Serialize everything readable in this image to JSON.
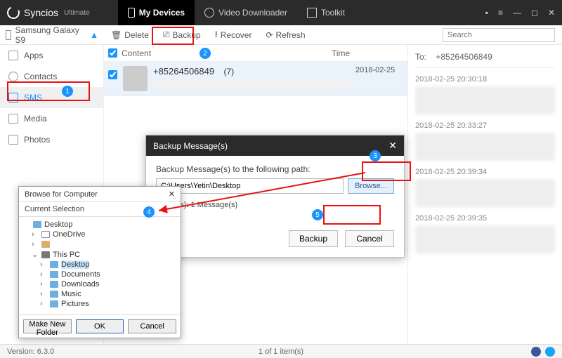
{
  "app": {
    "name": "Syncios",
    "edition": "Ultimate"
  },
  "nav": {
    "my_devices": "My Devices",
    "video_downloader": "Video Downloader",
    "toolkit": "Toolkit"
  },
  "device": {
    "name": "Samsung Galaxy S9"
  },
  "toolbar": {
    "delete": "Delete",
    "backup": "Backup",
    "recover": "Recover",
    "refresh": "Refresh"
  },
  "search": {
    "placeholder": "Search"
  },
  "sidebar": {
    "apps": "Apps",
    "contacts": "Contacts",
    "sms": "SMS",
    "media": "Media",
    "photos": "Photos"
  },
  "listhead": {
    "content": "Content",
    "time": "Time"
  },
  "conversation": {
    "number": "+85264506849",
    "count": "(7)",
    "time": "2018-02-25"
  },
  "rightpane": {
    "to_label": "To:",
    "to_value": "+85264506849",
    "msg_times": [
      "2018-02-25 20:30:18",
      "2018-02-25 20:33:27",
      "2018-02-25 20:39:34",
      "2018-02-25 20:39:35"
    ]
  },
  "backup_dialog": {
    "title": "Backup Message(s)",
    "prompt": "Backup Message(s) to the following path:",
    "path": "C:\\Users\\Yetin\\Desktop",
    "browse": "Browse...",
    "info": "1 Item(s): 1 Message(s)",
    "backup": "Backup",
    "cancel": "Cancel"
  },
  "browse_dialog": {
    "title": "Browse for Computer",
    "subtitle": "Current Selection",
    "tree": {
      "desktop": "Desktop",
      "onedrive": "OneDrive",
      "thispc": "This PC",
      "desktop2": "Desktop",
      "documents": "Documents",
      "downloads": "Downloads",
      "music": "Music",
      "pictures": "Pictures"
    },
    "make_new": "Make New Folder",
    "ok": "OK",
    "cancel": "Cancel"
  },
  "status": {
    "version": "Version: 6.3.0",
    "count": "1 of 1 item(s)"
  }
}
